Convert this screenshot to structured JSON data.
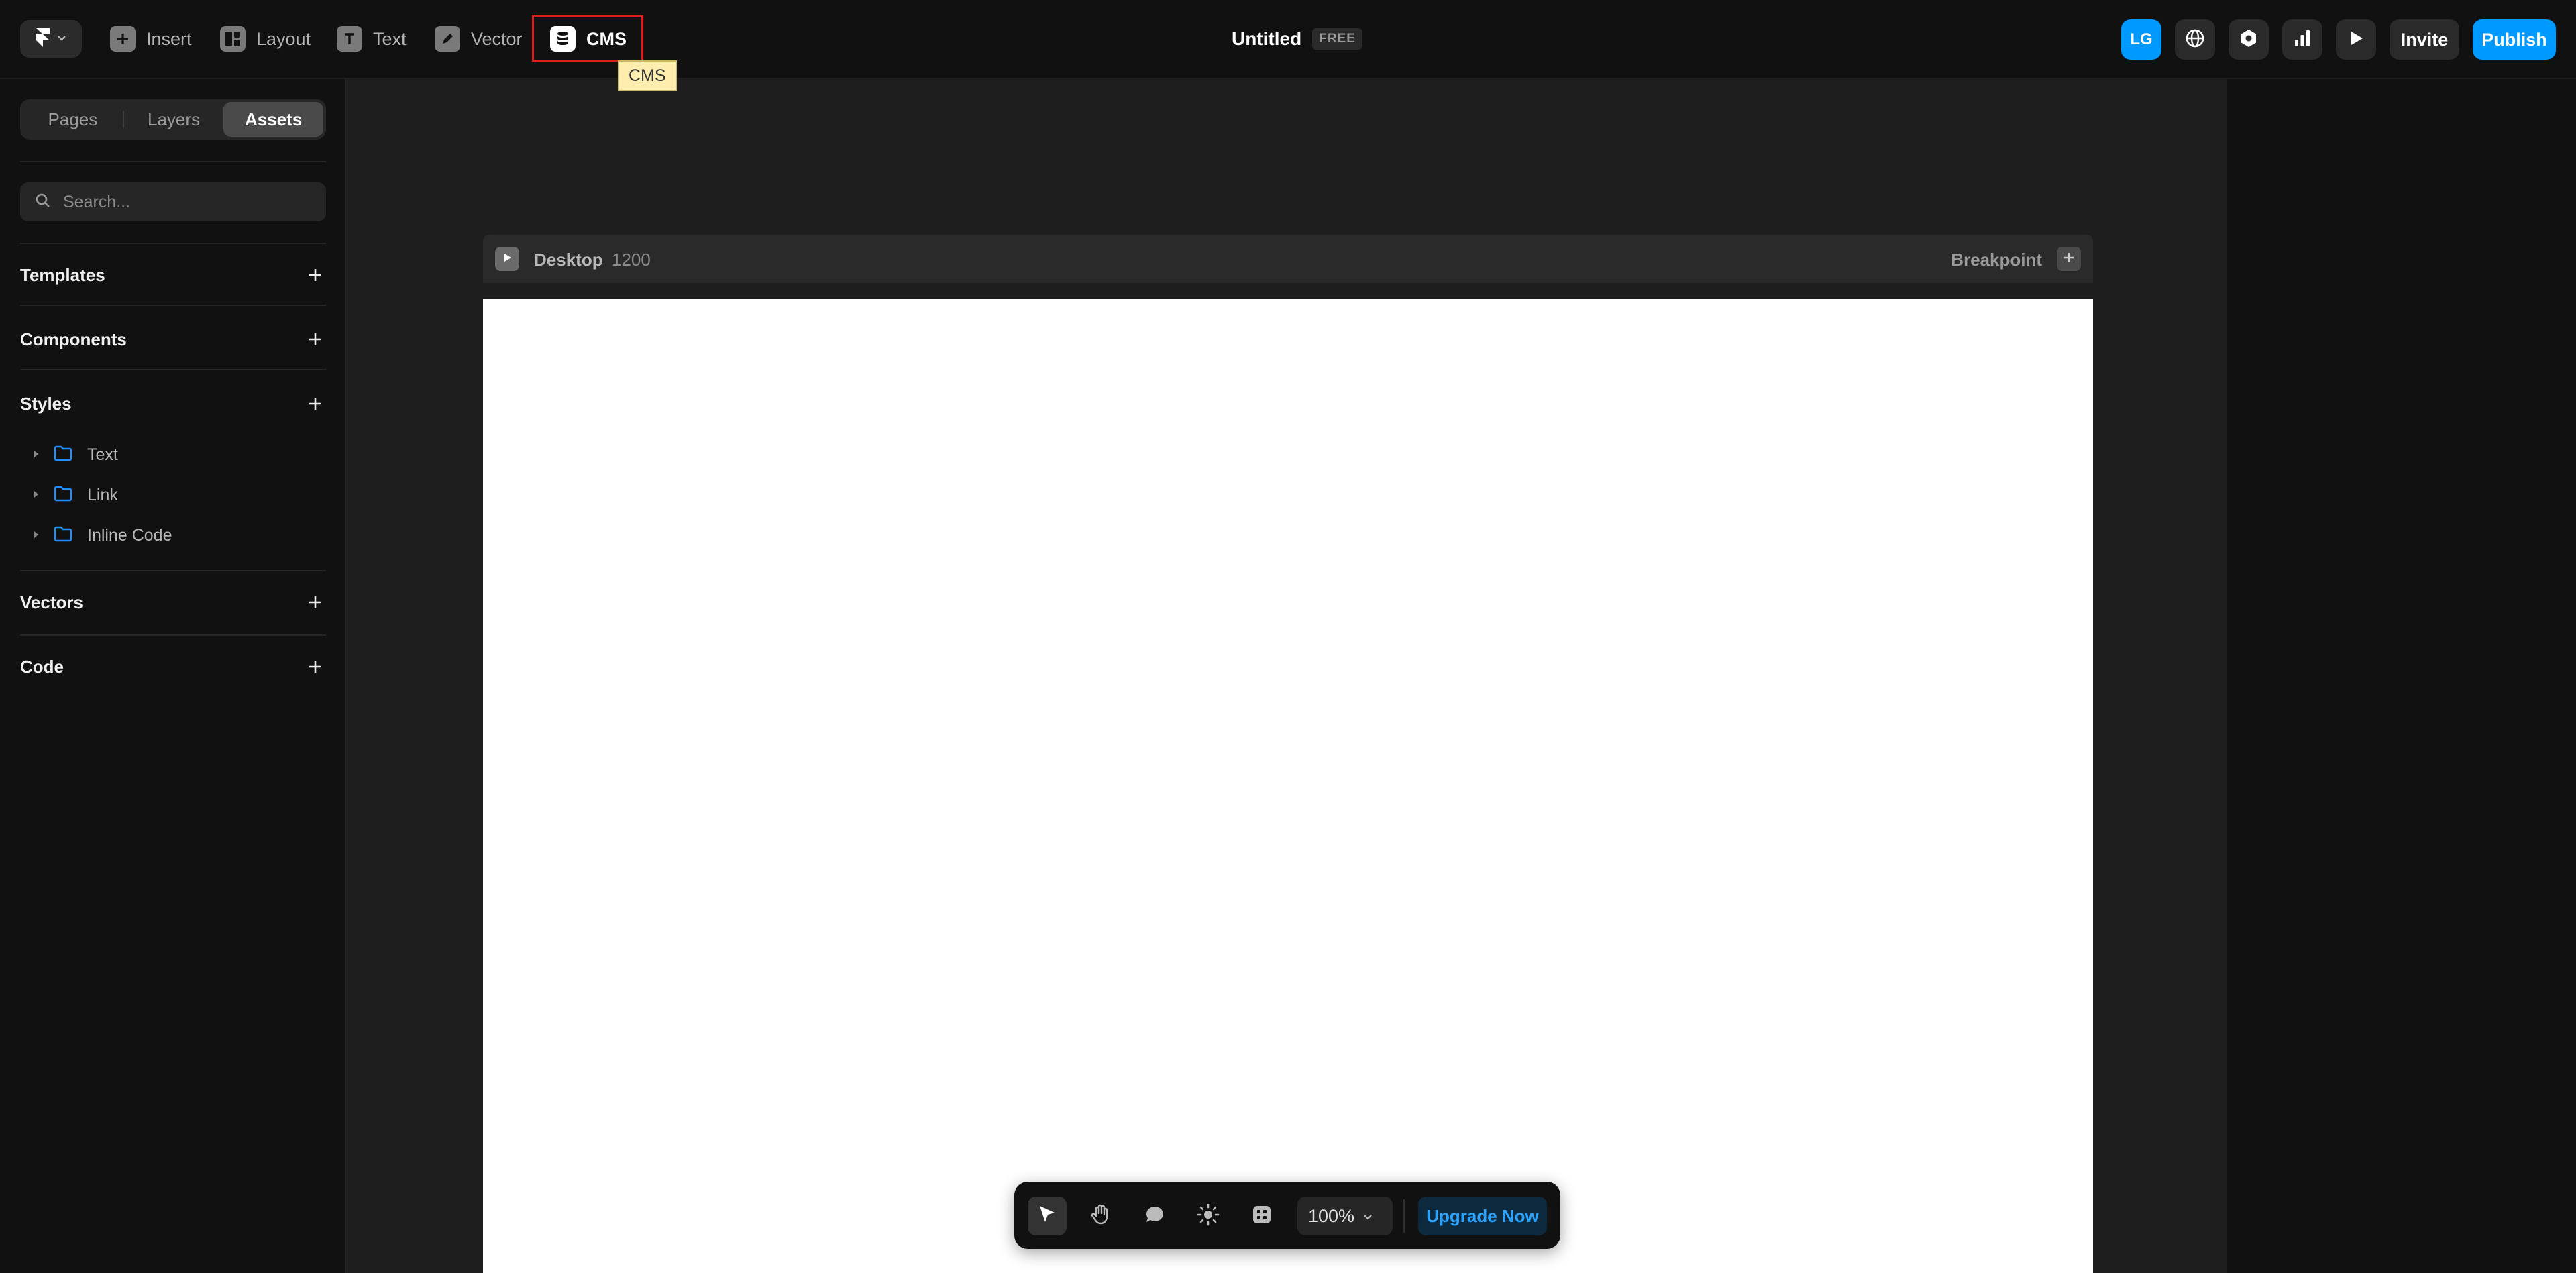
{
  "toolbar": {
    "items": [
      {
        "label": "Insert",
        "icon": "plus-square-icon"
      },
      {
        "label": "Layout",
        "icon": "layout-icon"
      },
      {
        "label": "Text",
        "icon": "text-icon"
      },
      {
        "label": "Vector",
        "icon": "pen-icon"
      },
      {
        "label": "CMS",
        "icon": "database-icon"
      }
    ],
    "tooltip": "CMS",
    "highlight_color": "#e01e1e"
  },
  "project": {
    "title": "Untitled",
    "plan_badge": "FREE"
  },
  "header_right": {
    "avatar_initials": "LG",
    "invite_label": "Invite",
    "publish_label": "Publish",
    "accent_color": "#0099ff"
  },
  "sidebar": {
    "tabs": [
      "Pages",
      "Layers",
      "Assets"
    ],
    "active_tab": "Assets",
    "search_placeholder": "Search...",
    "sections": {
      "templates": "Templates",
      "components": "Components",
      "styles": "Styles",
      "vectors": "Vectors",
      "code": "Code"
    },
    "style_items": [
      "Text",
      "Link",
      "Inline Code"
    ]
  },
  "canvas": {
    "frame_name": "Desktop",
    "frame_width": "1200",
    "breakpoint_label": "Breakpoint"
  },
  "bottom_toolbar": {
    "zoom": "100%",
    "upgrade_label": "Upgrade Now",
    "tools": [
      "select-icon",
      "hand-icon",
      "comment-icon",
      "sun-icon",
      "grid-icon"
    ]
  }
}
